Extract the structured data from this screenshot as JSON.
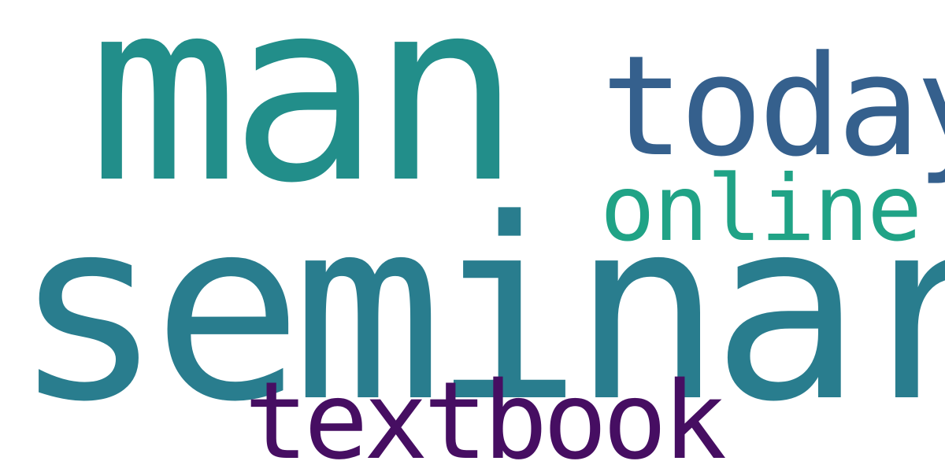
{
  "words": {
    "man": {
      "text": "man",
      "color": "#228e8a"
    },
    "today": {
      "text": "today",
      "color": "#35608d"
    },
    "online": {
      "text": "online",
      "color": "#20a386"
    },
    "seminar": {
      "text": "seminar",
      "color": "#297d8e"
    },
    "textbook": {
      "text": "textbook",
      "color": "#460e62"
    }
  }
}
